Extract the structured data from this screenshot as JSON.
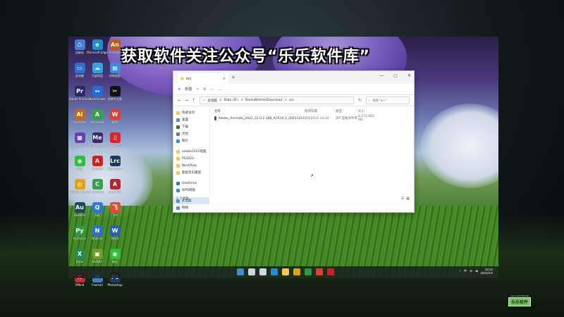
{
  "banner": {
    "text": "获取软件关注公众号“乐乐软件库”"
  },
  "desktop": {
    "icons": [
      {
        "label": "回收站",
        "color": "#3f7fd8",
        "glyph": "♺"
      },
      {
        "label": "Microsoft Edge",
        "color": "#1e8fd0",
        "glyph": "e"
      },
      {
        "label": "Animate",
        "color": "#c45a10",
        "glyph": "An"
      },
      {
        "label": "此电脑",
        "color": "#2e6fd0",
        "glyph": "▭"
      },
      {
        "label": "百度网盘",
        "color": "#2fa2e8",
        "glyph": "☁"
      },
      {
        "label": "控制面板",
        "color": "#3a8fd6",
        "glyph": "▤"
      },
      {
        "label": "Adobe Premiere",
        "color": "#2b2b6b",
        "glyph": "Pr"
      },
      {
        "label": "TeamViewer",
        "color": "#1c6fd6",
        "glyph": "↔"
      },
      {
        "label": "剪映专业版",
        "color": "#111111",
        "glyph": "✂"
      },
      {
        "label": "Illustrator",
        "color": "#c46a10",
        "glyph": "Ai"
      },
      {
        "label": "Anaconda",
        "color": "#3aa04a",
        "glyph": "A"
      },
      {
        "label": "WPS",
        "color": "#e3402f",
        "glyph": "W"
      },
      {
        "label": "Visual Studio",
        "color": "#6a3fb0",
        "glyph": "▦"
      },
      {
        "label": "Media Encoder",
        "color": "#3a2a6b",
        "glyph": "Me"
      },
      {
        "label": "网易云音乐",
        "color": "#d8242a",
        "glyph": "♫"
      },
      {
        "label": "微信",
        "color": "#2fbf3a",
        "glyph": "◉"
      },
      {
        "label": "Acrobat",
        "color": "#d11f1f",
        "glyph": "A"
      },
      {
        "label": "Lightroom",
        "color": "#1a3a5e",
        "glyph": "Lrc"
      },
      {
        "label": "Google Chrome",
        "color": "#e0a218",
        "glyph": "◎"
      },
      {
        "label": "Camtasia",
        "color": "#3aa04a",
        "glyph": "C"
      },
      {
        "label": "AutoCAD",
        "color": "#b4262c",
        "glyph": "A"
      },
      {
        "label": "Audition",
        "color": "#1a4a5e",
        "glyph": "Au"
      },
      {
        "label": "QQ",
        "color": "#2a7bd8",
        "glyph": "Q"
      },
      {
        "label": "飞书",
        "color": "#e14e2f",
        "glyph": "飞"
      },
      {
        "label": "PyCharm",
        "color": "#2a9a3a",
        "glyph": "Py"
      },
      {
        "label": "Navicat",
        "color": "#2e6fd0",
        "glyph": "N"
      },
      {
        "label": "Word",
        "color": "#2a5fb8",
        "glyph": "W"
      },
      {
        "label": "Excel",
        "color": "#2a8a4a",
        "glyph": "X"
      },
      {
        "label": "NVIDIA",
        "color": "#6aa02a",
        "glyph": "▣"
      },
      {
        "label": "微信",
        "color": "#2fbf3a",
        "glyph": "◉"
      },
      {
        "label": "XMind",
        "color": "#d8242a",
        "glyph": "X"
      },
      {
        "label": "Foxmail",
        "color": "#3a7fd0",
        "glyph": "✉"
      },
      {
        "label": "Photoshop",
        "color": "#1a3a6b",
        "glyph": "Ps"
      }
    ]
  },
  "explorer": {
    "tab_title": "arc",
    "tab_close": "×",
    "tab_add": "+",
    "window_controls": [
      "—",
      "▢",
      "✕"
    ],
    "toolbar": {
      "new_label": "新建",
      "more": "…"
    },
    "nav": {
      "back": "←",
      "forward": "→",
      "up": "↑",
      "refresh": "↻"
    },
    "address": {
      "segments": [
        "此电脑",
        "Data (D:)",
        "BaiduNetdiskDownload",
        "arc"
      ],
      "separator": ">"
    },
    "search": {
      "placeholder": "搜索\"arc\""
    },
    "nav_pane": [
      {
        "label": "快速访问",
        "color": "#f2c94c",
        "selected": false
      },
      {
        "label": "桌面",
        "color": "#4a90d9",
        "selected": false
      },
      {
        "label": "下载",
        "color": "#2e7d32",
        "selected": false
      },
      {
        "label": "文档",
        "color": "#6c7a89",
        "selected": false
      },
      {
        "label": "图片",
        "color": "#3a8fd6",
        "selected": false
      },
      {
        "label": "adobe2022电脑",
        "color": "#f2c94c",
        "selected": false
      },
      {
        "label": "PS2022",
        "color": "#f2c94c",
        "selected": false
      },
      {
        "label": "Workflow",
        "color": "#f2c94c",
        "selected": false
      },
      {
        "label": "超级音乐播放",
        "color": "#f2c94c",
        "selected": false
      },
      {
        "label": "OneDrive",
        "color": "#2e7fd8",
        "selected": false
      },
      {
        "label": "WPS网盘",
        "color": "#3a8fd6",
        "selected": false
      },
      {
        "label": "此电脑",
        "color": "#4a90d9",
        "selected": true
      },
      {
        "label": "网络",
        "color": "#4a90d9",
        "selected": false
      }
    ],
    "columns": {
      "name": "名称",
      "date": "修改日期",
      "type": "类型",
      "size": "大小"
    },
    "files": [
      {
        "name": "Adobe_Animate_2022_22.0.2.168_ACR14.1_20211214",
        "date": "2022/1/2 14:24",
        "type": "ZIP 压缩文件夹",
        "size": "2,171,062 KB"
      }
    ],
    "status": {
      "count": "1 个项目"
    },
    "view_icons": [
      "☰",
      "▦"
    ]
  },
  "taskbar": {
    "icons": [
      {
        "name": "start-icon",
        "color": "#3a8fd6"
      },
      {
        "name": "search-icon",
        "color": "#cfd6dd"
      },
      {
        "name": "task-view-icon",
        "color": "#cfd6dd"
      },
      {
        "name": "edge-icon",
        "color": "#1e8fd0"
      },
      {
        "name": "explorer-icon",
        "color": "#f2c94c"
      },
      {
        "name": "chrome-icon",
        "color": "#e0a218"
      },
      {
        "name": "app-icon",
        "color": "#2a9a3a"
      },
      {
        "name": "wps-icon",
        "color": "#e3402f"
      },
      {
        "name": "record-icon",
        "color": "#d11f1f"
      }
    ],
    "tray_symbols": [
      "^",
      "中",
      "⊕",
      "◀"
    ],
    "time": "19:23",
    "date": "2022/1/2"
  },
  "logo": {
    "small": "LE LE SOFTWARE",
    "big": "乐乐软件"
  }
}
